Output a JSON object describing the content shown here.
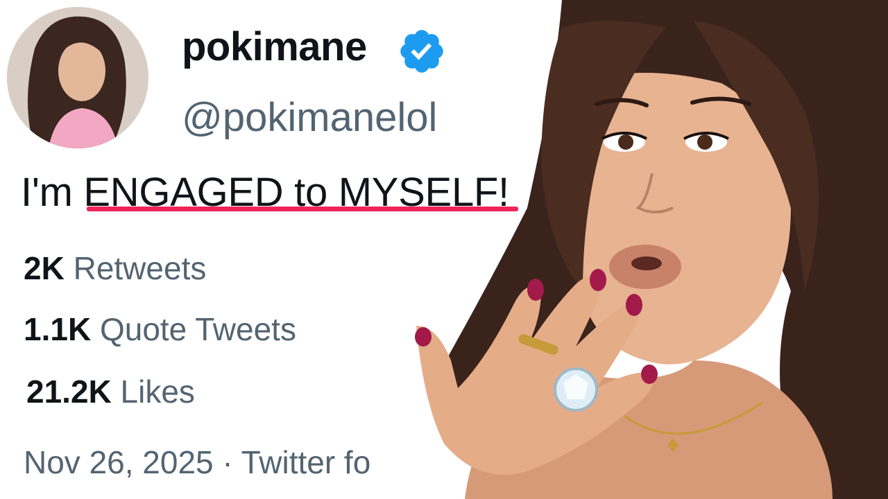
{
  "tweet": {
    "display_name": "pokimane",
    "handle": "@pokimanelol",
    "text": "I'm ENGAGED to MYSELF!",
    "stats": {
      "retweets": {
        "count": "2K",
        "label": "Retweets"
      },
      "quote_tweets": {
        "count": "1.1K",
        "label": "Quote Tweets"
      },
      "likes": {
        "count": "21.2K",
        "label": "Likes"
      }
    },
    "timestamp": "Nov 26, 2025 · Twitter fo"
  },
  "colors": {
    "verified": "#1d9bf0",
    "highlight_underline": "#f0245a",
    "secondary_text": "#536471",
    "primary_text": "#0f1419"
  },
  "icons": {
    "verified": "verified-badge-icon"
  }
}
